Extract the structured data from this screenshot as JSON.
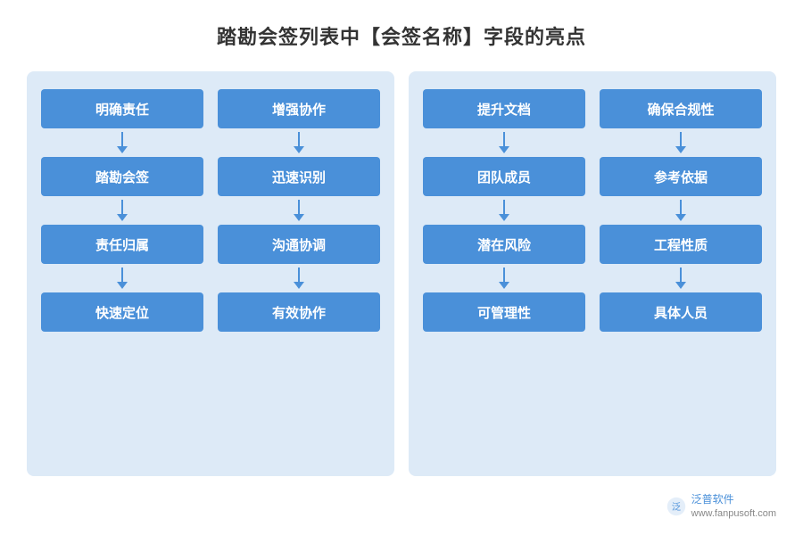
{
  "title": {
    "prefix": "踏勘会签列表中",
    "highlight": "【会签名称】",
    "suffix": "字段的亮点"
  },
  "leftPanel": {
    "columns": [
      {
        "header": "明确责任",
        "items": [
          "踏勘会签",
          "责任归属",
          "快速定位"
        ]
      },
      {
        "header": "增强协作",
        "items": [
          "迅速识别",
          "沟通协调",
          "有效协作"
        ]
      }
    ]
  },
  "rightPanel": {
    "columns": [
      {
        "header": "提升文档",
        "items": [
          "团队成员",
          "潜在风险",
          "可管理性"
        ]
      },
      {
        "header": "确保合规性",
        "items": [
          "参考依据",
          "工程性质",
          "具体人员"
        ]
      }
    ]
  },
  "watermark": {
    "brand": "泛普软件",
    "url": "www.fanpusoft.com"
  }
}
